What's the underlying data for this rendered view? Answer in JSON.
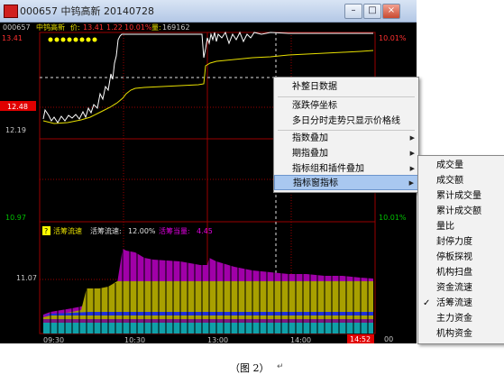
{
  "window": {
    "title": "000657 中钨高新 20140728",
    "buttons": {
      "minimize": "–",
      "restore": "□",
      "close": "×"
    }
  },
  "info_bar": {
    "code": "000657",
    "name": "中钨高新",
    "price_label": "价:",
    "price": "13.41",
    "change": "1.22",
    "change_pct": "10.01%",
    "volume_label": "量:",
    "volume": "169162"
  },
  "y_axis_left": {
    "top": "13.41",
    "highlight": "12.48",
    "mid": "12.19",
    "bottom": "10.97",
    "indicator_mid": "11.07"
  },
  "y_axis_right": {
    "top": "10.01%",
    "bottom": "10.01%"
  },
  "indicator": {
    "question_mark": "?",
    "name": "活筹流速",
    "speed_label": "活筹流速:",
    "speed_value": "12.00%",
    "active_label": "活筹当量:",
    "active_value": "4.45"
  },
  "time_axis": [
    "09:30",
    "10:30",
    "13:00",
    "14:00"
  ],
  "time_cursor": "14:52",
  "time_cut": "00",
  "colors": {
    "price_line": "#ffffff",
    "avg_line": "#e8e000",
    "grid": "#9a0000",
    "up_text": "#ff3030",
    "down_text": "#00c000",
    "purple": "#a000a8",
    "olive": "#a8a000",
    "cyan": "#10a0a8",
    "blue": "#2030d8"
  },
  "context_menu": {
    "items": [
      {
        "label": "补整日数据",
        "submenu": false
      },
      {
        "label": "涨跌停坐标",
        "submenu": false
      },
      {
        "label": "多日分时走势只显示价格线",
        "submenu": false
      },
      {
        "label": "指数叠加",
        "submenu": true
      },
      {
        "label": "期指叠加",
        "submenu": true
      },
      {
        "label": "指标组和插件叠加",
        "submenu": true
      },
      {
        "label": "指标窗指标",
        "submenu": true,
        "selected": true
      }
    ],
    "submenu_arrow": "▶"
  },
  "submenu": {
    "items": [
      {
        "label": "成交量"
      },
      {
        "label": "成交额"
      },
      {
        "label": "累计成交量"
      },
      {
        "label": "累计成交额"
      },
      {
        "label": "量比"
      },
      {
        "label": "封停力度"
      },
      {
        "label": "停板探视"
      },
      {
        "label": "机构扫盘"
      },
      {
        "label": "资金流速"
      },
      {
        "label": "活筹流速",
        "checked": true
      },
      {
        "label": "主力资金"
      },
      {
        "label": "机构资金"
      }
    ],
    "check_mark": "✓"
  },
  "caption": "（图 2）",
  "caption_mark": "↵"
}
